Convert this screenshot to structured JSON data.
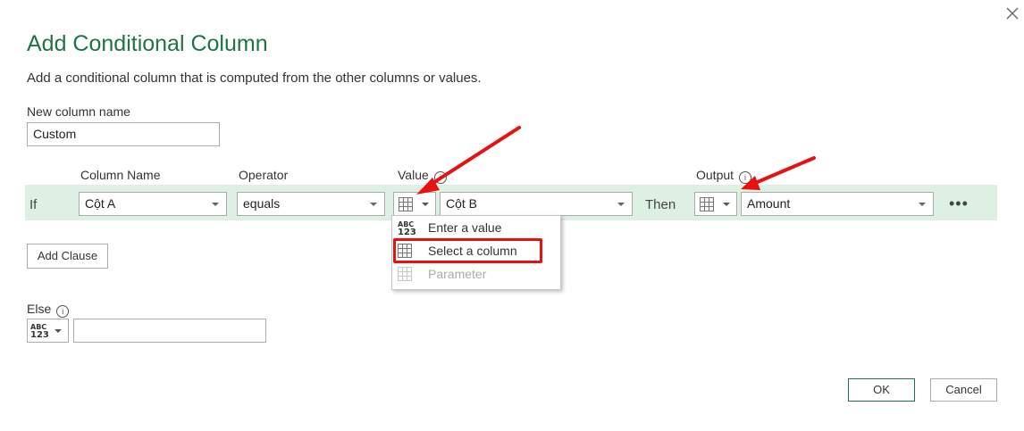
{
  "dialog": {
    "title": "Add Conditional Column",
    "subtitle": "Add a conditional column that is computed from the other columns or values."
  },
  "new_column": {
    "label": "New column name",
    "value": "Custom"
  },
  "headers": {
    "column_name": "Column Name",
    "operator": "Operator",
    "value": "Value",
    "output": "Output"
  },
  "clause": {
    "if_label": "If",
    "column": "Cột A",
    "operator": "equals",
    "value": "Cột B",
    "then_label": "Then",
    "output": "Amount"
  },
  "value_type_menu": {
    "items": [
      {
        "label": "Enter a value",
        "icon": "abc-123-icon",
        "enabled": true
      },
      {
        "label": "Select a column",
        "icon": "table-column-icon",
        "enabled": true,
        "highlighted": true
      },
      {
        "label": "Parameter",
        "icon": "parameter-icon",
        "enabled": false
      }
    ]
  },
  "buttons": {
    "add_clause": "Add Clause",
    "ok": "OK",
    "cancel": "Cancel",
    "more": "•••"
  },
  "else": {
    "label": "Else",
    "value": ""
  },
  "icon_text": {
    "abc": "ABC",
    "num": "123"
  },
  "colors": {
    "accent": "#217346",
    "row_background": "#ddf0e3",
    "annotation": "#e81010"
  }
}
